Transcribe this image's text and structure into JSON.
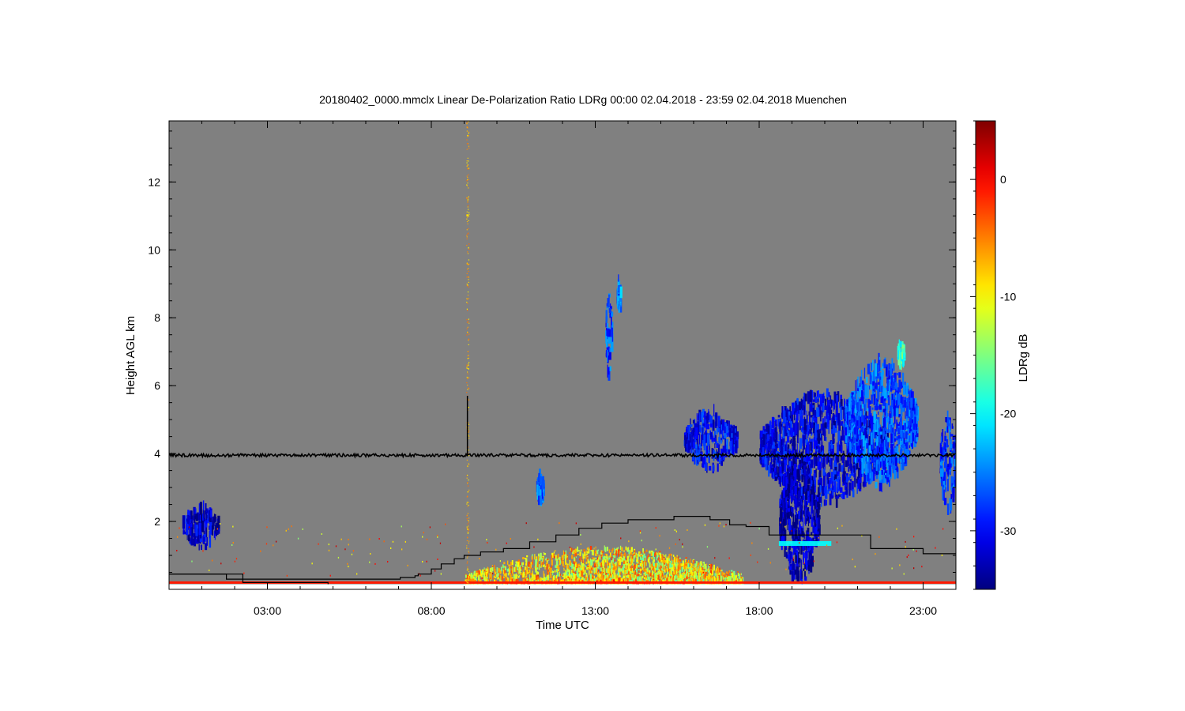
{
  "chart_data": {
    "type": "heatmap",
    "title": "20180402_0000.mmclx Linear De-Polarization Ratio LDRg   00:00 02.04.2018 - 23:59 02.04.2018 Muenchen",
    "xlabel": "Time UTC",
    "ylabel": "Height AGL km",
    "colorbar_label": "LDRg dB",
    "x_unit": "hours UTC",
    "xlim": [
      0,
      24
    ],
    "ylim": [
      0,
      13.8
    ],
    "clim": [
      -35,
      5
    ],
    "x_ticks": [
      {
        "value": 3,
        "label": "03:00"
      },
      {
        "value": 8,
        "label": "08:00"
      },
      {
        "value": 13,
        "label": "13:00"
      },
      {
        "value": 18,
        "label": "18:00"
      },
      {
        "value": 23,
        "label": "23:00"
      }
    ],
    "y_ticks": [
      {
        "value": 2,
        "label": "2"
      },
      {
        "value": 4,
        "label": "4"
      },
      {
        "value": 6,
        "label": "6"
      },
      {
        "value": 8,
        "label": "8"
      },
      {
        "value": 10,
        "label": "10"
      },
      {
        "value": 12,
        "label": "12"
      }
    ],
    "colorbar_ticks": [
      {
        "value": 0,
        "label": "0"
      },
      {
        "value": -10,
        "label": "-10"
      },
      {
        "value": -20,
        "label": "-20"
      },
      {
        "value": -30,
        "label": "-30"
      }
    ],
    "background_color": "#808080",
    "colormap": [
      "#00007f",
      "#0000ff",
      "#007fff",
      "#00ffff",
      "#7fff7f",
      "#ffff00",
      "#ff7f00",
      "#ff0000",
      "#7f0000"
    ],
    "cloud_regions": [
      {
        "t0": 0.4,
        "t1": 1.5,
        "h0": 1.2,
        "h1": 2.5,
        "ldr": -32
      },
      {
        "t0": 13.3,
        "t1": 13.5,
        "h0": 6.2,
        "h1": 8.8,
        "ldr": -27
      },
      {
        "t0": 13.65,
        "t1": 13.75,
        "h0": 8.2,
        "h1": 9.1,
        "ldr": -25
      },
      {
        "t0": 11.2,
        "t1": 11.4,
        "h0": 2.5,
        "h1": 3.4,
        "ldr": -26
      },
      {
        "t0": 15.7,
        "t1": 17.3,
        "h0": 3.5,
        "h1": 5.3,
        "ldr": -30
      },
      {
        "t0": 18.0,
        "t1": 21.9,
        "h0": 2.5,
        "h1": 5.8,
        "ldr": -31
      },
      {
        "t0": 18.6,
        "t1": 19.8,
        "h0": 0.1,
        "h1": 4.0,
        "ldr": -33
      },
      {
        "t0": 20.6,
        "t1": 22.8,
        "h0": 3.0,
        "h1": 6.8,
        "ldr": -27
      },
      {
        "t0": 22.2,
        "t1": 22.4,
        "h0": 6.5,
        "h1": 7.3,
        "ldr": -18
      },
      {
        "t0": 23.5,
        "t1": 24.0,
        "h0": 2.2,
        "h1": 5.3,
        "ldr": -28
      }
    ],
    "precip_regions": [
      {
        "t0": 9.0,
        "t1": 17.5,
        "h0": 0.1,
        "h1": 1.3,
        "ldr": -9
      },
      {
        "t0": 12.0,
        "t1": 16.5,
        "h0": 0.2,
        "h1": 1.2,
        "ldr": -10
      },
      {
        "t0": 9.5,
        "t1": 16.8,
        "h0": 0.05,
        "h1": 0.35,
        "ldr": -5
      }
    ],
    "melting_layer": {
      "t0": 18.6,
      "t1": 20.2,
      "h": 1.35,
      "ldr": -20
    },
    "surface_clutter": {
      "t0": 0,
      "t1": 24,
      "h": 0.2,
      "ldr": -1
    },
    "vertical_spike_line": {
      "t": 9.1,
      "h0": 0,
      "h1": 13.8,
      "ldr": -7
    },
    "noise_line": {
      "h": 3.95,
      "spike": {
        "t": 9.1,
        "h": 5.7
      }
    },
    "cloud_base_steps": [
      [
        0,
        0.45
      ],
      [
        1.7,
        0.45
      ],
      [
        1.75,
        0.3
      ],
      [
        7.0,
        0.3
      ],
      [
        7.05,
        0.35
      ],
      [
        7.5,
        0.4
      ],
      [
        7.6,
        0.45
      ],
      [
        8.0,
        0.6
      ],
      [
        8.3,
        0.75
      ],
      [
        8.7,
        0.9
      ],
      [
        9.0,
        1.0
      ],
      [
        9.5,
        1.1
      ],
      [
        10.2,
        1.2
      ],
      [
        11.0,
        1.4
      ],
      [
        11.8,
        1.6
      ],
      [
        12.5,
        1.8
      ],
      [
        13.2,
        1.95
      ],
      [
        14.0,
        2.05
      ],
      [
        15.4,
        2.15
      ],
      [
        16.5,
        2.05
      ],
      [
        17.1,
        1.9
      ],
      [
        17.6,
        1.85
      ],
      [
        18.3,
        1.6
      ],
      [
        19.5,
        1.6
      ],
      [
        21.4,
        1.2
      ],
      [
        23.0,
        1.05
      ],
      [
        24.0,
        1.05
      ]
    ],
    "lower_steps": [
      [
        0,
        0.45
      ],
      [
        2.2,
        0.45
      ],
      [
        2.25,
        0.2
      ],
      [
        4.8,
        0.2
      ],
      [
        4.85,
        0.05
      ],
      [
        6.3,
        0.05
      ],
      [
        6.35,
        0
      ]
    ]
  }
}
